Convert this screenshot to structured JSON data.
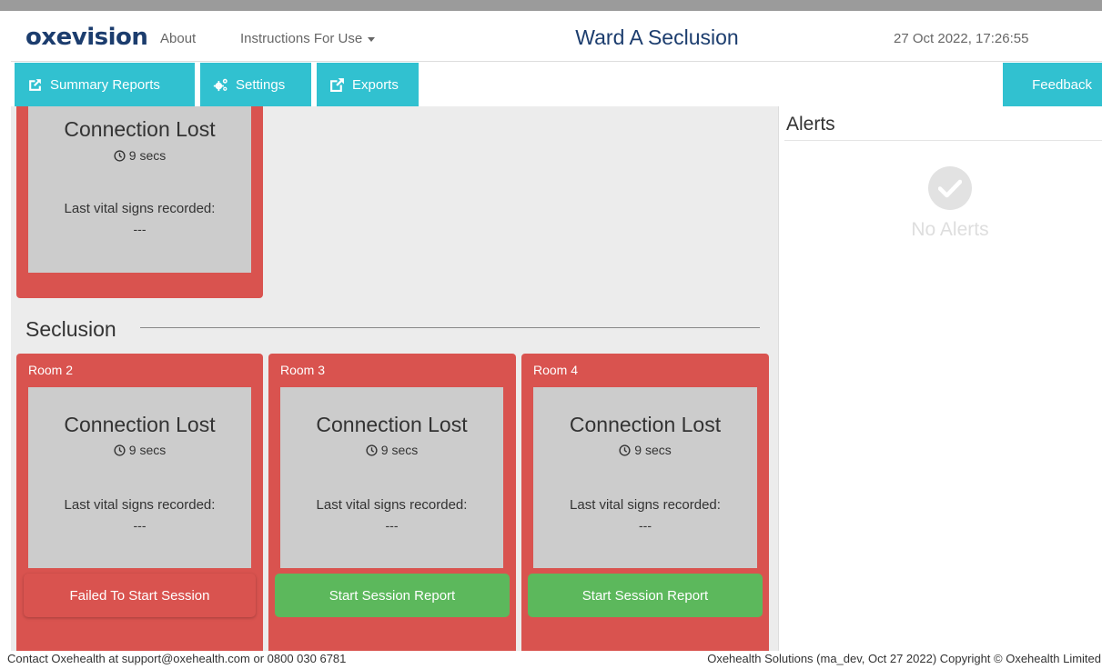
{
  "header": {
    "logo_text": "oxevision",
    "nav_about": "About",
    "nav_instructions": "Instructions For Use",
    "page_title": "Ward A Seclusion",
    "datetime": "27 Oct 2022, 17:26:55"
  },
  "toolbar": {
    "summary_reports": "Summary Reports",
    "settings": "Settings",
    "exports": "Exports",
    "feedback": "Feedback"
  },
  "top_card": {
    "status": "Connection Lost",
    "elapsed": "9 secs",
    "last_vitals_label": "Last vital signs recorded:",
    "last_vitals_value": "---"
  },
  "section": {
    "title": "Seclusion"
  },
  "rooms": [
    {
      "label": "Room 2",
      "status": "Connection Lost",
      "elapsed": "9 secs",
      "last_vitals_label": "Last vital signs recorded:",
      "last_vitals_value": "---",
      "action_label": "Failed To Start Session"
    },
    {
      "label": "Room 3",
      "status": "Connection Lost",
      "elapsed": "9 secs",
      "last_vitals_label": "Last vital signs recorded:",
      "last_vitals_value": "---",
      "action_label": "Start Session Report"
    },
    {
      "label": "Room 4",
      "status": "Connection Lost",
      "elapsed": "9 secs",
      "last_vitals_label": "Last vital signs recorded:",
      "last_vitals_value": "---",
      "action_label": "Start Session Report"
    }
  ],
  "alerts": {
    "title": "Alerts",
    "empty_text": "No Alerts"
  },
  "footer": {
    "contact": "Contact Oxehealth at support@oxehealth.com or 0800 030 6781",
    "copyright": "Oxehealth Solutions (ma_dev, Oct 27 2022) Copyright © Oxehealth Limited"
  },
  "colors": {
    "accent": "#31c1d0",
    "card_red": "#d9534f",
    "button_green": "#5cb85c",
    "brand_navy": "#1c3d6e"
  },
  "icons": {
    "summary_reports": "share-square-icon",
    "settings": "cogs-icon",
    "exports": "external-link-icon",
    "elapsed": "clock-icon",
    "no_alerts": "check-circle-icon"
  }
}
